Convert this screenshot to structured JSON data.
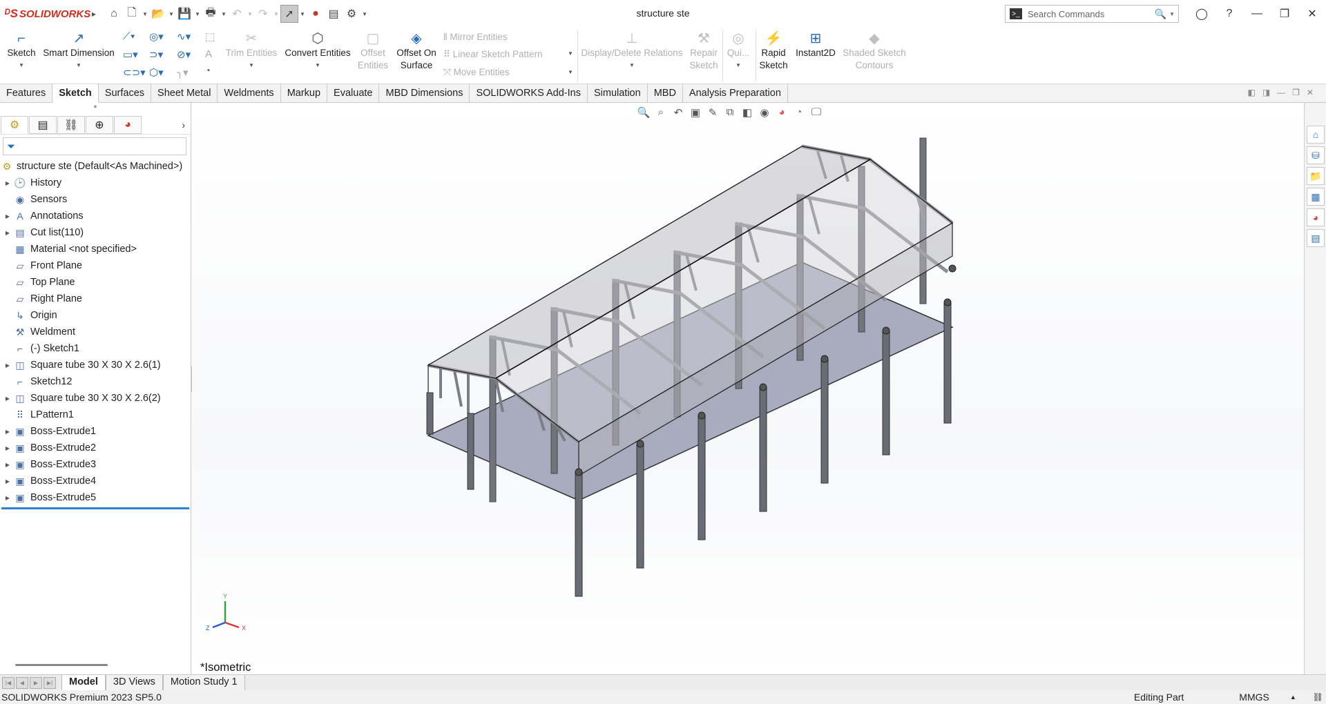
{
  "app": {
    "brand": "SOLIDWORKS",
    "document_title": "structure ste",
    "search_placeholder": "Search Commands"
  },
  "command_manager": {
    "sketch": "Sketch",
    "smart_dimension": "Smart Dimension",
    "trim_entities": "Trim Entities",
    "convert_entities": "Convert Entities",
    "offset_entities_1": "Offset",
    "offset_entities_2": "Entities",
    "offset_on_surface_1": "Offset On",
    "offset_on_surface_2": "Surface",
    "mirror_entities": "Mirror Entities",
    "linear_sketch_pattern": "Linear Sketch Pattern",
    "move_entities": "Move Entities",
    "display_delete_relations": "Display/Delete Relations",
    "repair_sketch_1": "Repair",
    "repair_sketch_2": "Sketch",
    "quick_snaps": "Qui...",
    "rapid_sketch_1": "Rapid",
    "rapid_sketch_2": "Sketch",
    "instant2d": "Instant2D",
    "shaded_sketch_contours_1": "Shaded Sketch",
    "shaded_sketch_contours_2": "Contours"
  },
  "tabs": [
    "Features",
    "Sketch",
    "Surfaces",
    "Sheet Metal",
    "Weldments",
    "Markup",
    "Evaluate",
    "MBD Dimensions",
    "SOLIDWORKS Add-Ins",
    "Simulation",
    "MBD",
    "Analysis Preparation"
  ],
  "active_tab": "Sketch",
  "feature_tree": {
    "root": "structure ste  (Default<As Machined>)",
    "items": [
      {
        "label": "History",
        "icon": "history-icon",
        "expandable": true
      },
      {
        "label": "Sensors",
        "icon": "sensors-icon",
        "expandable": false
      },
      {
        "label": "Annotations",
        "icon": "annotations-icon",
        "expandable": true
      },
      {
        "label": "Cut list(110)",
        "icon": "cut-list-icon",
        "expandable": true
      },
      {
        "label": "Material <not specified>",
        "icon": "material-icon",
        "expandable": false
      },
      {
        "label": "Front Plane",
        "icon": "plane-icon",
        "expandable": false
      },
      {
        "label": "Top Plane",
        "icon": "plane-icon",
        "expandable": false
      },
      {
        "label": "Right Plane",
        "icon": "plane-icon",
        "expandable": false
      },
      {
        "label": "Origin",
        "icon": "origin-icon",
        "expandable": false
      },
      {
        "label": "Weldment",
        "icon": "weldment-icon",
        "expandable": false
      },
      {
        "label": "(-) Sketch1",
        "icon": "sketch-icon",
        "expandable": false
      },
      {
        "label": "Square tube 30 X 30 X 2.6(1)",
        "icon": "structural-member-icon",
        "expandable": true
      },
      {
        "label": "Sketch12",
        "icon": "sketch-icon",
        "expandable": false
      },
      {
        "label": "Square tube 30 X 30 X 2.6(2)",
        "icon": "structural-member-icon",
        "expandable": true
      },
      {
        "label": "LPattern1",
        "icon": "linear-pattern-icon",
        "expandable": false
      },
      {
        "label": "Boss-Extrude1",
        "icon": "extrude-icon",
        "expandable": true
      },
      {
        "label": "Boss-Extrude2",
        "icon": "extrude-icon",
        "expandable": true
      },
      {
        "label": "Boss-Extrude3",
        "icon": "extrude-icon",
        "expandable": true
      },
      {
        "label": "Boss-Extrude4",
        "icon": "extrude-icon",
        "expandable": true
      },
      {
        "label": "Boss-Extrude5",
        "icon": "extrude-icon",
        "expandable": true
      }
    ]
  },
  "viewport": {
    "view_name": "*Isometric",
    "triad": {
      "x": "X",
      "y": "Y",
      "z": "Z"
    }
  },
  "bottom_tabs": [
    "Model",
    "3D Views",
    "Motion Study 1"
  ],
  "active_bottom_tab": "Model",
  "status": {
    "version": "SOLIDWORKS Premium 2023 SP5.0",
    "mode": "Editing Part",
    "units": "MMGS"
  },
  "colors": {
    "accent": "#2a7fd1",
    "brand_red": "#d52b1e",
    "floor_fill": "#a7a9bf",
    "frame_steel": "#6f7078"
  }
}
